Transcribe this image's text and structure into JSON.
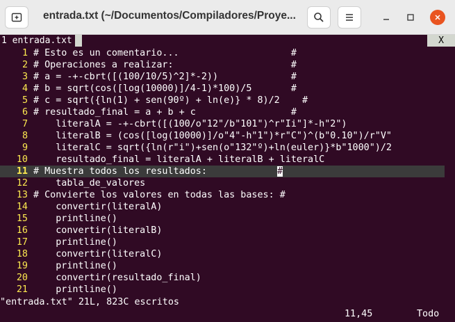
{
  "window": {
    "title": "entrada.txt (~/Documentos/Compiladores/Proye..."
  },
  "tabline": {
    "active_tab": "1 entrada.txt",
    "close_label": "X"
  },
  "editor": {
    "lines": [
      {
        "num": "1",
        "text": "# Esto es un comentario...                    #"
      },
      {
        "num": "2",
        "text": "# Operaciones a realizar:                     #"
      },
      {
        "num": "3",
        "text": "# a = -+-cbrt([(100/10/5)^2]*-2))             #"
      },
      {
        "num": "4",
        "text": "# b = sqrt(cos([log(10000)]/4-1)*100)/5       #"
      },
      {
        "num": "5",
        "text": "# c = sqrt({ln(1) + sen(90º) + ln(e)} * 8)/2    #"
      },
      {
        "num": "6",
        "text": "# resultado_final = a + b + c                 #"
      },
      {
        "num": "7",
        "text": "    literalA = -+-cbrt([(100/o\"12\"/b\"101\")^r\"Ii\"]*-h\"2\")"
      },
      {
        "num": "8",
        "text": "    literalB = (cos([log(10000)]/o\"4\"-h\"1\")*r\"C\")^(b\"0.10\")/r\"V\""
      },
      {
        "num": "9",
        "text": "    literalC = sqrt({ln(r\"i\")+sen(o\"132\"º)+ln(euler)}*b\"1000\")/2"
      },
      {
        "num": "10",
        "text": "    resultado_final = literalA + literalB + literalC"
      },
      {
        "num": "11",
        "text": "# Muestra todos los resultados:"
      },
      {
        "num": "12",
        "text": "    tabla_de_valores"
      },
      {
        "num": "13",
        "text": "# Convierte los valores en todas las bases: #"
      },
      {
        "num": "14",
        "text": "    convertir(literalA)"
      },
      {
        "num": "15",
        "text": "    printline()"
      },
      {
        "num": "16",
        "text": "    convertir(literalB)"
      },
      {
        "num": "17",
        "text": "    printline()"
      },
      {
        "num": "18",
        "text": "    convertir(literalC)"
      },
      {
        "num": "19",
        "text": "    printline()"
      },
      {
        "num": "20",
        "text": "    convertir(resultado_final)"
      },
      {
        "num": "21",
        "text": "    printline()"
      }
    ],
    "cursor_char": "#"
  },
  "statusline": {
    "message": "\"entrada.txt\" 21L, 823C escritos",
    "position": "11,45",
    "scroll": "Todo"
  }
}
